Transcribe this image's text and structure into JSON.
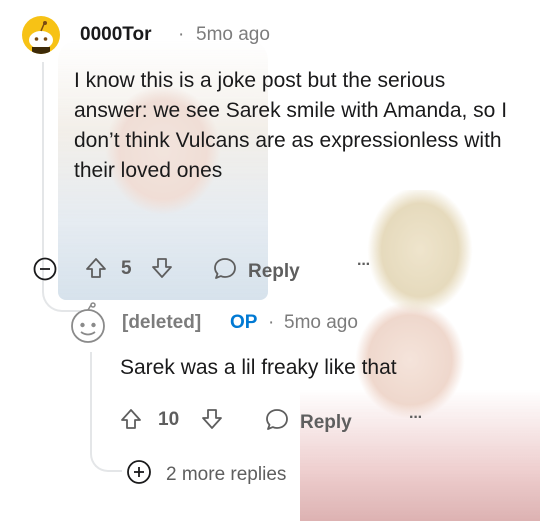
{
  "comment": {
    "author": "0000Tor",
    "separator": "·",
    "age": "5mo ago",
    "body": "I know this is a joke post but the serious answer: we see Sarek smile with Amanda, so I don’t think Vulcans are as expressionless with their loved ones",
    "vote_count": "5",
    "reply_label": "Reply",
    "more_label": "···"
  },
  "reply": {
    "author": "[deleted]",
    "op_badge": "OP",
    "separator": "·",
    "age": "5mo ago",
    "body": "Sarek was a lil freaky like that",
    "vote_count": "10",
    "reply_label": "Reply",
    "more_label": "···"
  },
  "more_replies_label": "2 more replies",
  "colors": {
    "text": "#1a1a1b",
    "muted": "#7c7c7c",
    "op_blue": "#0079d3",
    "snoo_yellow": "#f7c215"
  },
  "icons": [
    "snoo-avatar-icon",
    "collapse-icon",
    "upvote-icon",
    "downvote-icon",
    "speech-bubble-icon",
    "deleted-user-icon",
    "plus-circle-icon"
  ]
}
